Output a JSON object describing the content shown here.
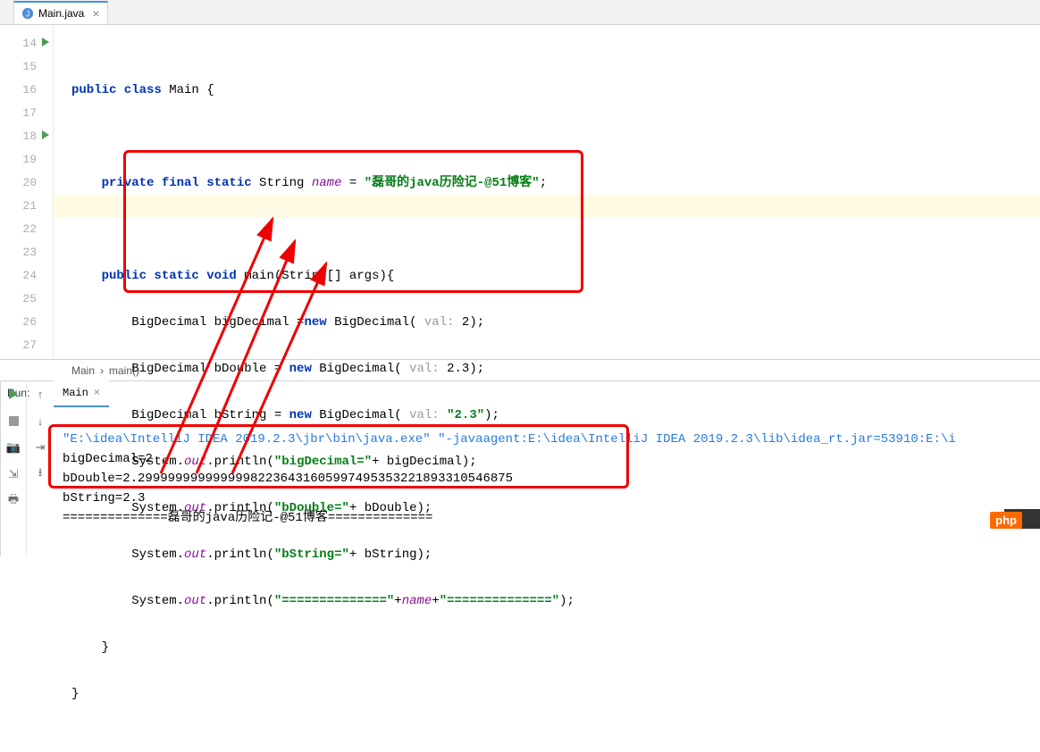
{
  "tab": {
    "name": "Main.java",
    "close": "×"
  },
  "lines": [
    "14",
    "15",
    "16",
    "17",
    "18",
    "19",
    "20",
    "21",
    "22",
    "23",
    "24",
    "25",
    "26",
    "27"
  ],
  "code": {
    "l14": {
      "a": "public class ",
      "b": "Main {"
    },
    "l16": {
      "a": "private final static ",
      "b": "String ",
      "c": "name",
      "d": " = ",
      "e": "\"磊哥的java历险记-@51博客\"",
      "f": ";"
    },
    "l18": {
      "a": "public static void ",
      "b": "main(String[] args){"
    },
    "l19": {
      "a": "BigDecimal bigDecimal =",
      "b": "new ",
      "c": "BigDecimal(",
      "d": " val: ",
      "e": "2",
      "f": ");"
    },
    "l20": {
      "a": "BigDecimal bDouble = ",
      "b": "new ",
      "c": "BigDecimal(",
      "d": " val: ",
      "e": "2.3",
      "f": ");"
    },
    "l21": {
      "a": "BigDecimal bString = ",
      "b": "new ",
      "c": "BigDecimal(",
      "d": " val: ",
      "e": "\"2.3\"",
      "f": ");"
    },
    "l22": {
      "a": "System.",
      "b": "out",
      "c": ".println(",
      "d": "\"bigDecimal=\"",
      "e": "+ bigDecimal);"
    },
    "l23": {
      "a": "System.",
      "b": "out",
      "c": ".println(",
      "d": "\"bDouble=\"",
      "e": "+ bDouble);"
    },
    "l24": {
      "a": "System.",
      "b": "out",
      "c": ".println(",
      "d": "\"bString=\"",
      "e": "+ bString);"
    },
    "l25": {
      "a": "System.",
      "b": "out",
      "c": ".println(",
      "d": "\"==============\"",
      "e": "+",
      "f": "name",
      "g": "+",
      "h": "\"==============\"",
      "i": ");"
    },
    "l26": "}",
    "l27": "}"
  },
  "breadcrumb": {
    "a": "Main",
    "b": "›",
    "c": "main()"
  },
  "run": {
    "label": "Run:",
    "tab": "Main",
    "tabclose": "×",
    "cmd": "\"E:\\idea\\IntelliJ IDEA 2019.2.3\\jbr\\bin\\java.exe\" \"-javaagent:E:\\idea\\IntelliJ IDEA 2019.2.3\\lib\\idea_rt.jar=53910:E:\\i",
    "o1": "bigDecimal=2",
    "o2": "bDouble=2.29999999999999982236431605997495353221893310546875",
    "o3": "bString=2.3",
    "o4": "==============磊哥的java历险记-@51博客=============="
  },
  "badge": "php"
}
